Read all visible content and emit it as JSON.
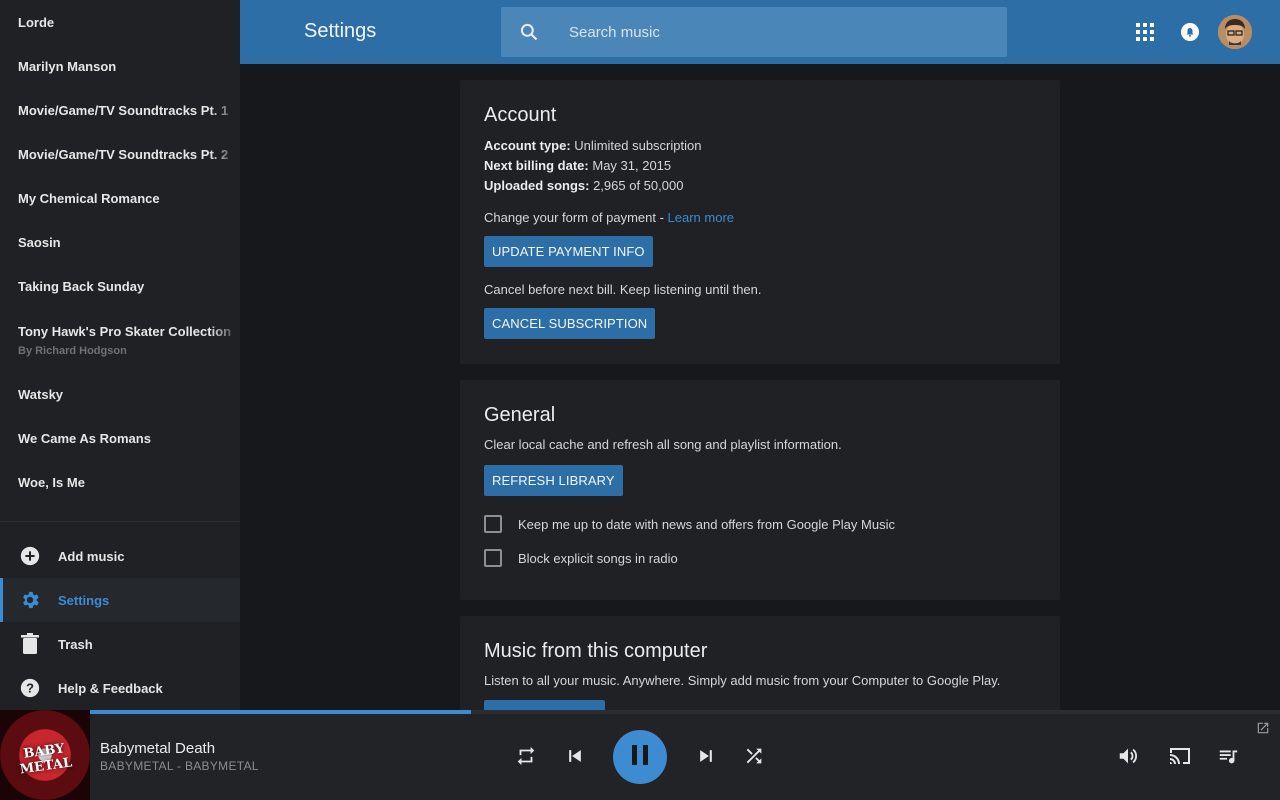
{
  "sidebar": {
    "artists": [
      {
        "label": "Lorde"
      },
      {
        "label": "Marilyn Manson"
      },
      {
        "label": "Movie/Game/TV Soundtracks Pt. 1"
      },
      {
        "label": "Movie/Game/TV Soundtracks Pt. 2"
      },
      {
        "label": "My Chemical Romance"
      },
      {
        "label": "Saosin"
      },
      {
        "label": "Taking Back Sunday"
      },
      {
        "label": "Tony Hawk's Pro Skater Collection",
        "sub": "By Richard Hodgson"
      },
      {
        "label": "Watsky"
      },
      {
        "label": "We Came As Romans"
      },
      {
        "label": "Woe, Is Me"
      }
    ],
    "actions": {
      "add_music": "Add music",
      "settings": "Settings",
      "trash": "Trash",
      "help": "Help & Feedback"
    }
  },
  "header": {
    "title": "Settings",
    "search_placeholder": "Search music"
  },
  "account": {
    "heading": "Account",
    "type_label": "Account type:",
    "type_value": "Unlimited subscription",
    "billing_label": "Next billing date:",
    "billing_value": "May 31, 2015",
    "uploaded_label": "Uploaded songs:",
    "uploaded_value": "2,965 of 50,000",
    "payment_text": "Change your form of payment - ",
    "learn_more": "Learn more",
    "update_button": "UPDATE PAYMENT INFO",
    "cancel_text": "Cancel before next bill. Keep listening until then.",
    "cancel_button": "CANCEL SUBSCRIPTION"
  },
  "general": {
    "heading": "General",
    "cache_text": "Clear local cache and refresh all song and playlist information.",
    "refresh_button": "REFRESH LIBRARY",
    "news_label": "Keep me up to date with news and offers from Google Play Music",
    "news_checked": false,
    "explicit_label": "Block explicit songs in radio",
    "explicit_checked": false
  },
  "computer": {
    "heading": "Music from this computer",
    "text": "Listen to all your music. Anywhere. Simply add music from your Computer to Google Play."
  },
  "player": {
    "album_art_text": "BABY METAL",
    "title": "Babymetal Death",
    "subtitle": "BABYMETAL - BABYMETAL",
    "progress": 0.32,
    "state": "playing"
  },
  "colors": {
    "accent": "#3d8bd1",
    "header": "#2d6ea6",
    "sidebar": "#1f2125",
    "background": "#16181b"
  }
}
